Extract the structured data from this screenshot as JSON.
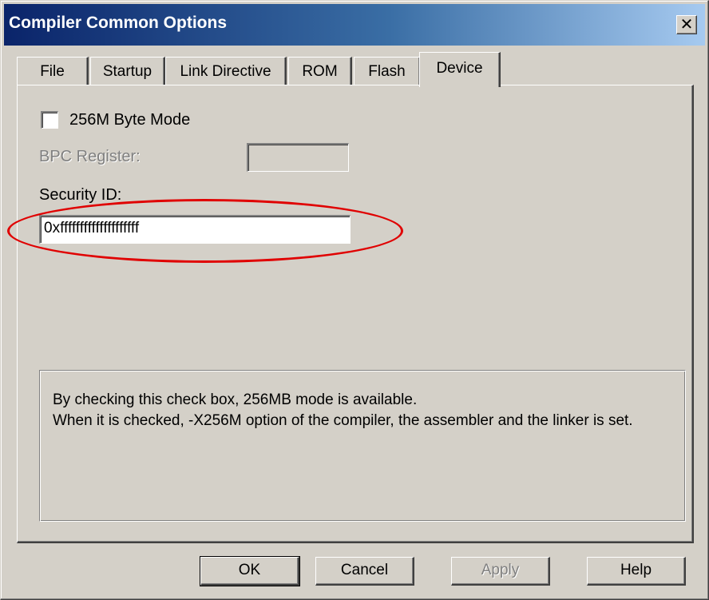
{
  "window": {
    "title": "Compiler Common Options",
    "close_glyph": "✕"
  },
  "tabs": [
    {
      "label": "File",
      "active": false
    },
    {
      "label": "Startup",
      "active": false
    },
    {
      "label": "Link Directive",
      "active": false
    },
    {
      "label": "ROM",
      "active": false
    },
    {
      "label": "Flash",
      "active": false
    },
    {
      "label": "Device",
      "active": true
    }
  ],
  "device": {
    "byte_mode": {
      "label": "256M Byte Mode",
      "checked": false
    },
    "bpc_register": {
      "label": "BPC Register:",
      "value": "",
      "enabled": false
    },
    "security_id": {
      "label": "Security ID:",
      "value": "0xffffffffffffffffffff"
    }
  },
  "description": {
    "line1": "By checking this check box, 256MB mode is available.",
    "line2": "When it is checked, -X256M option of the compiler, the assembler and the linker is set."
  },
  "buttons": {
    "ok": "OK",
    "cancel": "Cancel",
    "apply": "Apply",
    "help": "Help"
  },
  "annotation": {
    "color": "#e00000"
  }
}
